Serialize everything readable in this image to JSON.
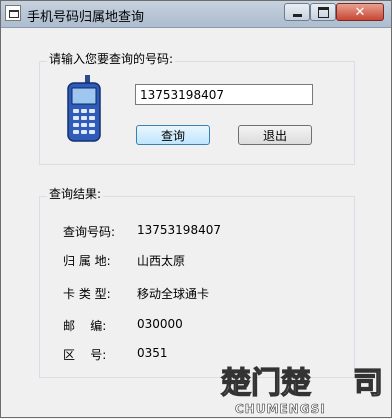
{
  "window": {
    "title": "手机号码归属地查询",
    "controls": {
      "minimize": "",
      "maximize": "",
      "close": "✕"
    }
  },
  "query": {
    "group_label": "请输入您要查询的号码:",
    "phone_input_value": "13753198407",
    "query_button": "查询",
    "exit_button": "退出"
  },
  "result": {
    "group_label": "查询结果:",
    "rows": [
      {
        "label": "查询号码:",
        "value": "13753198407"
      },
      {
        "label": "归 属 地:",
        "value": "山西太原"
      },
      {
        "label": "卡 类 型:",
        "value": "移动全球通卡"
      },
      {
        "label": "邮    编:",
        "value": "030000"
      },
      {
        "label": "区    号:",
        "value": "0351"
      }
    ]
  },
  "watermark": {
    "text": "楚门楚",
    "text2": "司",
    "subtext": "CHUMENGSI"
  }
}
